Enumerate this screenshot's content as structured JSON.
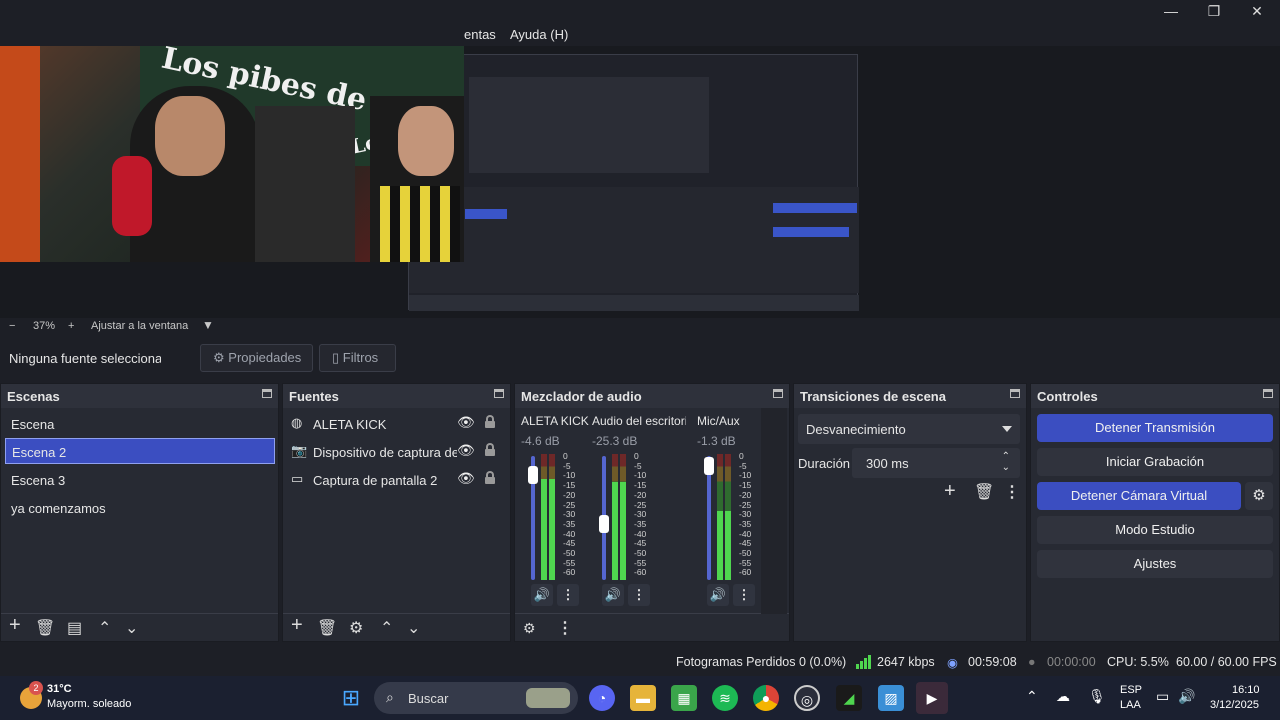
{
  "window": {
    "minimize_glyph": "—",
    "maximize_glyph": "❐",
    "close_glyph": "✕"
  },
  "menu": {
    "tools_partial": "entas",
    "help": "Ayuda (H)"
  },
  "preview": {
    "banner_text_1": "Los pibes de",
    "banner_text_2": "Los Pibes"
  },
  "zoom": {
    "minus": "−",
    "level": "37%",
    "plus": "+",
    "fit": "Ajustar a la ventana"
  },
  "source_toolbar": {
    "no_source": "Ninguna fuente seleccionada",
    "properties": "Propiedades",
    "filters": "Filtros"
  },
  "scenes": {
    "title": "Escenas",
    "items": [
      "Escena",
      "Escena 2",
      "Escena 3",
      "ya comenzamos"
    ],
    "active_index": 1
  },
  "sources": {
    "title": "Fuentes",
    "items": [
      {
        "label": "ALETA KICK",
        "icon": "globe-icon"
      },
      {
        "label": "Dispositivo de captura de video",
        "icon": "camera-icon"
      },
      {
        "label": "Captura de pantalla 2",
        "icon": "monitor-icon"
      }
    ]
  },
  "mixer": {
    "title": "Mezclador de audio",
    "channels": [
      {
        "name": "ALETA KICK",
        "db": "-4.6 dB",
        "fader": 0.85,
        "level": 0.8
      },
      {
        "name": "Audio del escritorio",
        "db": "-25.3 dB",
        "fader": 0.45,
        "level": 0.78
      },
      {
        "name": "Mic/Aux",
        "db": "-1.3 dB",
        "fader": 0.92,
        "level": 0.55
      }
    ],
    "scale": [
      "0",
      "-5",
      "-10",
      "-15",
      "-20",
      "-25",
      "-30",
      "-35",
      "-40",
      "-45",
      "-50",
      "-55",
      "-60"
    ]
  },
  "transitions": {
    "title": "Transiciones de escena",
    "selected": "Desvanecimiento",
    "duration_label": "Duración",
    "duration_value": "300 ms"
  },
  "controls": {
    "title": "Controles",
    "stop_stream": "Detener Transmisión",
    "start_recording": "Iniciar Grabación",
    "stop_virtual_cam": "Detener Cámara Virtual",
    "studio_mode": "Modo Estudio",
    "settings": "Ajustes"
  },
  "status": {
    "dropped_frames": "Fotogramas Perdidos 0 (0.0%)",
    "bitrate": "2647 kbps",
    "stream_time": "00:59:08",
    "record_time": "00:00:00",
    "cpu": "CPU: 5.5%",
    "fps": "60.00 / 60.00 FPS"
  },
  "taskbar": {
    "weather_badge": "2",
    "temperature": "31°C",
    "weather_desc": "Mayorm. soleado",
    "search_placeholder": "Buscar",
    "lang_top": "ESP",
    "lang_bottom": "LAA",
    "time": "16:10",
    "date": "3/12/2025"
  },
  "colors": {
    "accent": "#3b4ec1",
    "panel": "#272a33",
    "background": "#1d1f26",
    "meter_green": "#4fd64f"
  }
}
